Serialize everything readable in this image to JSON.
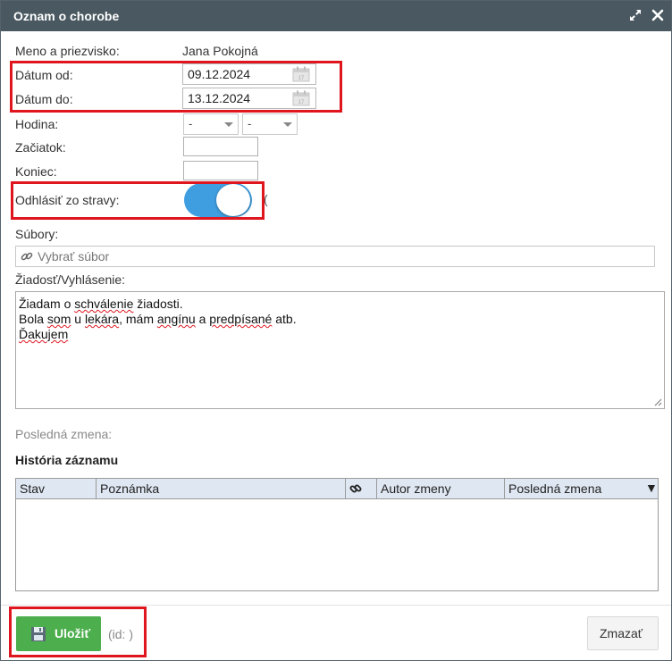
{
  "dialog": {
    "title": "Oznam o chorobe",
    "title_bar_color": "#4a5961"
  },
  "form": {
    "name_label": "Meno a priezvisko:",
    "name_value": "Jana Pokojná",
    "date_from_label": "Dátum od:",
    "date_from_value": "09.12.2024",
    "date_to_label": "Dátum do:",
    "date_to_value": "13.12.2024",
    "hour_label": "Hodina:",
    "hour_from_selected": "-",
    "hour_to_selected": "-",
    "start_label": "Začiatok:",
    "end_label": "Koniec:",
    "meal_label": "Odhlásiť zo stravy:",
    "meal_toggle_on": true,
    "meal_trailing": "(",
    "files_label": "Súbory:",
    "files_placeholder": "Vybrať súbor",
    "request_label": "Žiadosť/Vyhlásenie:",
    "request_lines": [
      "Žiadam o schválenie žiadosti.",
      "Bola som u lekára, mám angínu a predpísané atb.",
      "Ďakujem"
    ],
    "last_change_label": "Posledná zmena:"
  },
  "history": {
    "title": "História záznamu",
    "columns": [
      "Stav",
      "Poznámka",
      "",
      "Autor zmeny",
      "Posledná zmena"
    ],
    "sort_indicator": "▼",
    "rows": []
  },
  "footer": {
    "save_label": "Uložiť",
    "id_text": "(id: )",
    "delete_label": "Zmazať"
  },
  "colors": {
    "accent_toggle": "#3f9ee0",
    "save_button": "#4cae4c",
    "highlight": "#e0161f"
  }
}
